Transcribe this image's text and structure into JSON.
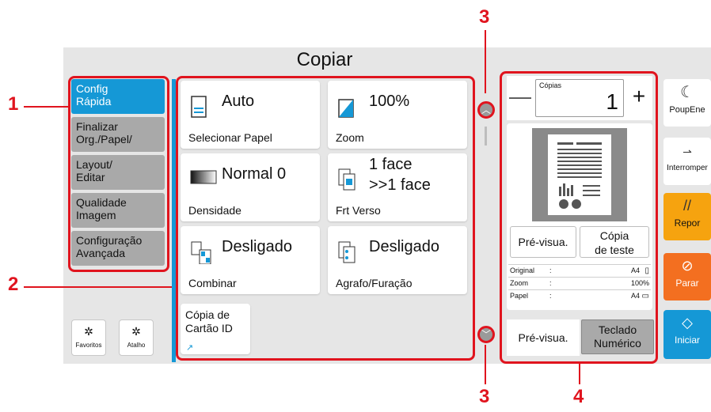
{
  "title": "Copiar",
  "left_menu": [
    {
      "label_1": "Config",
      "label_2": "Rápida"
    },
    {
      "label_1": "Finalizar",
      "label_2": "Org./Papel/"
    },
    {
      "label_1": "Layout/",
      "label_2": "Editar"
    },
    {
      "label_1": "Qualidade",
      "label_2": "Imagem"
    },
    {
      "label_1": "Configuração",
      "label_2": "Avançada"
    }
  ],
  "shortcuts": [
    {
      "label": "Favoritos",
      "icon": "gear-icon"
    },
    {
      "label": "Atalho",
      "icon": "gear-icon"
    }
  ],
  "tiles": [
    {
      "value": "Auto",
      "caption": "Selecionar Papel",
      "icon": "paper-icon"
    },
    {
      "value": "100%",
      "caption": "Zoom",
      "icon": "zoom-icon"
    },
    {
      "value": "Normal 0",
      "caption": "Densidade",
      "icon": "density-icon"
    },
    {
      "value_1": "1 face",
      "value_2": ">>1 face",
      "caption": "Frt Verso",
      "icon": "duplex-icon"
    },
    {
      "value": "Desligado",
      "caption": "Combinar",
      "icon": "combine-icon"
    },
    {
      "value": "Desligado",
      "caption": "Agrafo/Furação",
      "icon": "staple-icon"
    },
    {
      "value_1": "Cópia de",
      "value_2": "Cartão ID",
      "icon": "shortcut-arrow-icon"
    }
  ],
  "copies": {
    "label": "Cópias",
    "value": "1",
    "minus": "—",
    "plus": "+"
  },
  "preview": {
    "btn_preview": "Pré-visua.",
    "btn_test_1": "Cópia",
    "btn_test_2": "de teste",
    "rows": [
      {
        "key": "Original",
        "sep": ":",
        "value": "A4"
      },
      {
        "key": "Zoom",
        "sep": ":",
        "value": "100%"
      },
      {
        "key": "Papel",
        "sep": ":",
        "value": "A4"
      }
    ],
    "tab_preview": "Pré-visua.",
    "tab_keypad_1": "Teclado",
    "tab_keypad_2": "Numérico"
  },
  "side_buttons": [
    {
      "label": "PoupEne",
      "icon": "moon-icon",
      "color": "#ffffff"
    },
    {
      "label": "Interromper",
      "icon": "interrupt-icon",
      "color": "#ffffff"
    },
    {
      "label": "Repor",
      "icon": "reset-icon",
      "color": "#f6a30f"
    },
    {
      "label": "Parar",
      "icon": "stop-icon",
      "color": "#f36f20"
    },
    {
      "label": "Iniciar",
      "icon": "start-icon",
      "color": "#1598d6"
    }
  ],
  "callouts": {
    "c1": "1",
    "c2": "2",
    "c3_top": "3",
    "c3_bottom": "3",
    "c4": "4"
  },
  "colors": {
    "accent": "#1598d6",
    "callout": "#e0141e"
  }
}
